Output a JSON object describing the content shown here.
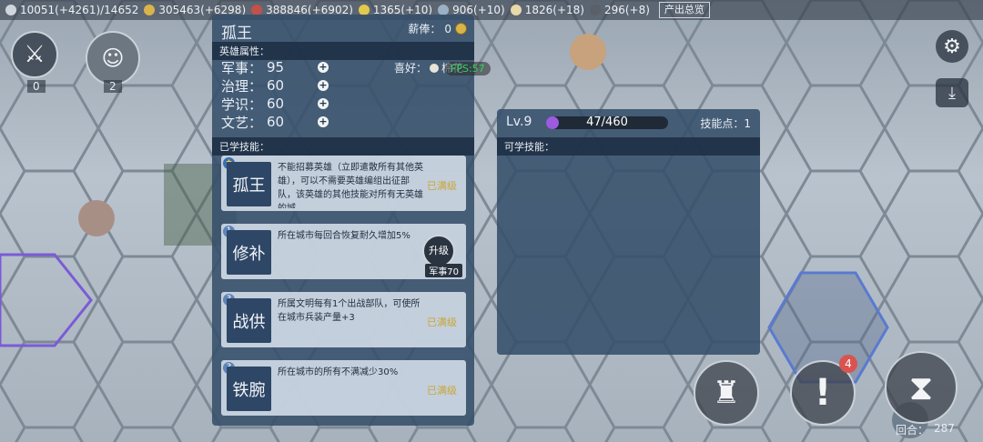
{
  "topbar": {
    "resources": [
      {
        "icon": "people-icon",
        "text": "10051(+4261)/14652"
      },
      {
        "icon": "coin-icon",
        "text": "305463(+6298)"
      },
      {
        "icon": "meat-icon",
        "text": "388846(+6902)"
      },
      {
        "icon": "science-icon",
        "text": "1365(+10)"
      },
      {
        "icon": "culture-icon",
        "text": "906(+10)"
      },
      {
        "icon": "faith-icon",
        "text": "1826(+18)"
      },
      {
        "icon": "gear-icon",
        "text": "296(+8)"
      }
    ],
    "output_summary": "产出总览"
  },
  "left_counters": {
    "military": "0",
    "hero": "2"
  },
  "hero_panel": {
    "name": "孤王",
    "salary_label": "薪俸：",
    "salary_value": "0",
    "attr_header": "英雄属性：",
    "attributes": [
      {
        "label": "军事：",
        "value": "95"
      },
      {
        "label": "治理：",
        "value": "60"
      },
      {
        "label": "学识：",
        "value": "60"
      },
      {
        "label": "文艺：",
        "value": "60"
      }
    ],
    "hobby_label": "喜好：",
    "hobby_value": "棉花",
    "fps": "FPS:57",
    "learned_header": "已学技能：",
    "skills": [
      {
        "badge": "★",
        "name": "孤王",
        "desc": "不能招募英雄（立即遣散所有其他英雄），可以不需要英雄编组出征部队，该英雄的其他技能对所有无英雄的城",
        "status": "已满级"
      },
      {
        "badge": "1",
        "name": "修补",
        "desc": "所在城市每回合恢复耐久增加5%",
        "status": "",
        "upgrade": "升级",
        "upgrade_req": "军事70"
      },
      {
        "badge": "3",
        "name": "战供",
        "desc": "所属文明每有1个出战部队，可使所在城市兵装产量+3",
        "status": "已满级"
      },
      {
        "badge": "3",
        "name": "铁腕",
        "desc": "所在城市的所有不满减少30%",
        "status": "已满级"
      }
    ]
  },
  "skill_panel": {
    "level": "Lv.9",
    "exp": "47/460",
    "exp_fraction": 0.102,
    "points_label": "技能点：1",
    "learnable_header": "可学技能："
  },
  "bottom": {
    "turn_label": "回合：",
    "turn_value": "287",
    "alert_count": "4"
  },
  "colors": {
    "accent": "#c9a636",
    "exp_bar": "#9b5ce0",
    "panel": "#364e6a"
  }
}
